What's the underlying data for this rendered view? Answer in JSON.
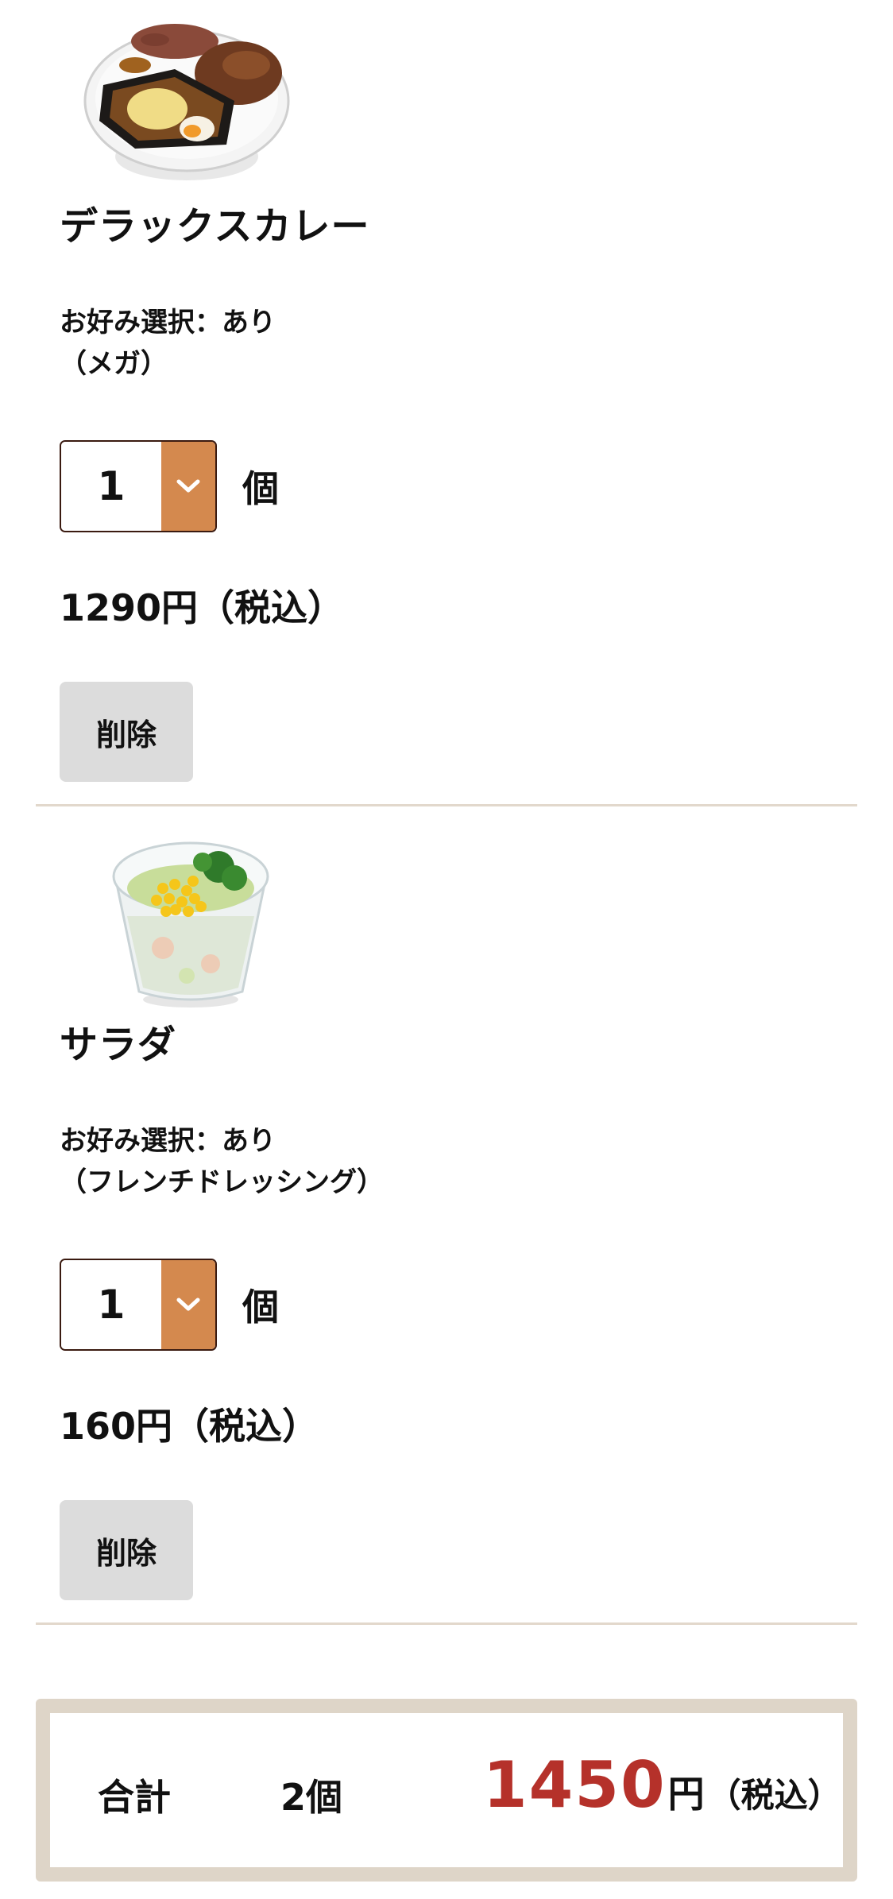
{
  "cart": {
    "items": [
      {
        "image_icon": "curry-bowl-image",
        "name": "デラックスカレー",
        "option_line1": "お好み選択：あり",
        "option_line2": "（メガ）",
        "quantity": "1",
        "quantity_unit": "個",
        "price": "1290円（税込）",
        "delete_label": "削除"
      },
      {
        "image_icon": "salad-cup-image",
        "name": "サラダ",
        "option_line1": "お好み選択：あり",
        "option_line2": "（フレンチドレッシング）",
        "quantity": "1",
        "quantity_unit": "個",
        "price": "160円（税込）",
        "delete_label": "削除"
      }
    ]
  },
  "summary": {
    "label": "合計",
    "count": "2個",
    "total_amount": "1450",
    "total_yen": "円",
    "total_tax": "（税込）"
  },
  "colors": {
    "accent_orange": "#d4894e",
    "total_red": "#b5312a",
    "border_beige": "#ded5c8",
    "divider": "#e2d8cc",
    "delete_bg": "#dcdcdc"
  }
}
